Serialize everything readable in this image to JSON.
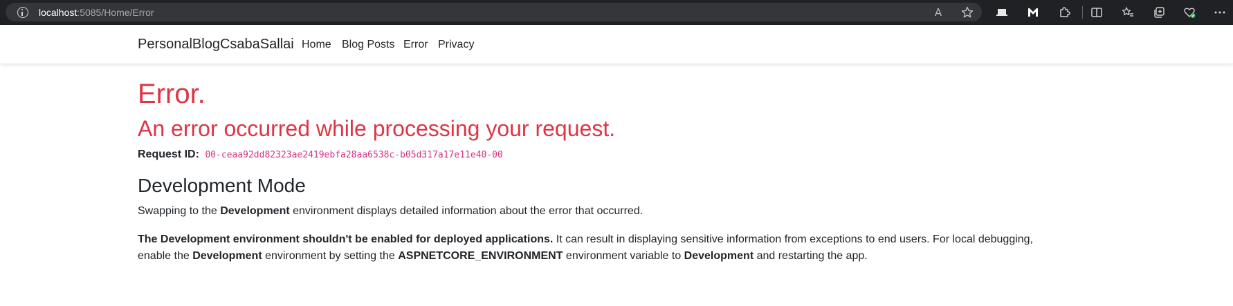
{
  "browser": {
    "url_host": "localhost",
    "url_rest": ":5085/Home/Error",
    "read_aloud_label": "A",
    "icons": [
      "info-icon",
      "read-aloud-icon",
      "favorite-star-icon",
      "extension-laptop-icon",
      "malwarebytes-icon",
      "extensions-puzzle-icon",
      "split-screen-icon",
      "favorites-icon",
      "collections-icon",
      "browser-essentials-icon",
      "more-icon"
    ]
  },
  "navbar": {
    "brand": "PersonalBlogCsabaSallai",
    "links": [
      "Home",
      "Blog Posts",
      "Error",
      "Privacy"
    ]
  },
  "main": {
    "title": "Error.",
    "subtitle": "An error occurred while processing your request.",
    "request_id_label": "Request ID:",
    "request_id": "00-ceaa92dd82323ae2419ebfa28aa6538c-b05d317a17e11e40-00",
    "dev_title": "Development Mode",
    "para1": {
      "pre": "Swapping to the ",
      "bold": "Development",
      "post": " environment displays detailed information about the error that occurred."
    },
    "para2": {
      "b1": "The Development environment shouldn't be enabled for deployed applications.",
      "t1": " It can result in displaying sensitive information from exceptions to end users. For local debugging, enable the ",
      "b2": "Development",
      "t2": " environment by setting the ",
      "b3": "ASPNETCORE_ENVIRONMENT",
      "t3": " environment variable to ",
      "b4": "Development",
      "t4": " and restarting the app."
    }
  },
  "colors": {
    "danger": "#dc3545",
    "code": "#d63384",
    "text": "#212529",
    "chrome_bg": "#202124",
    "addr_bg": "#35363a"
  }
}
